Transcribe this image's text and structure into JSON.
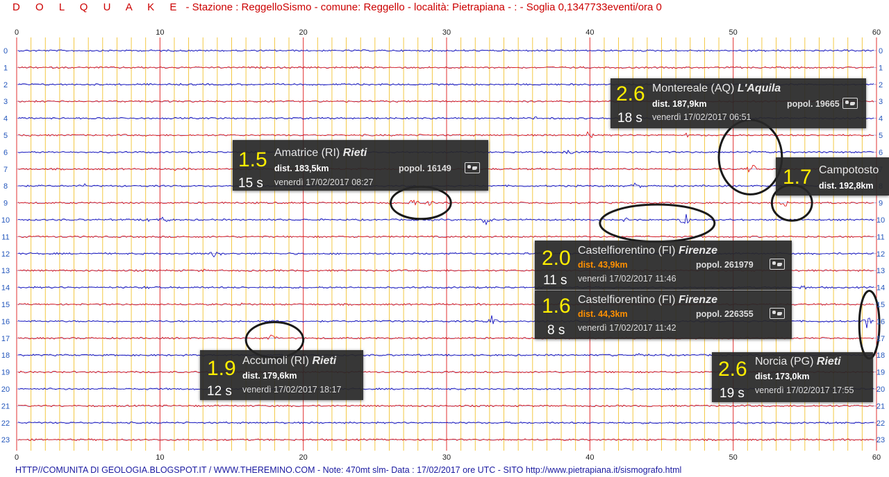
{
  "header": {
    "logo": "D O L Q U A  K E",
    "station": " - Stazione : ReggelloSismo - comune: Reggello - località: Pietrapiana - :  -  Soglia 0,1347733eventi/ora 0"
  },
  "footer": {
    "text": "HTTP//COMUNITA DI GEOLOGIA.BLOGSPOT.IT   /   WWW.THEREMINO.COM   -   Note: 470mt slm- Data : 17/02/2017 ore UTC - SITO http://www.pietrapiana.it/sismografo.html"
  },
  "colors": {
    "trace_red": "#dd0000",
    "trace_blue": "#0000bb",
    "grid_minor": "#f2c230",
    "grid_major": "#e03030",
    "grid_hour": "#9a9ad8",
    "axis_label": "#2255bb",
    "magnitude": "#ffee00",
    "near_distance": "#ff9000"
  },
  "chart_data": {
    "type": "line",
    "title": "",
    "xlabel": "",
    "ylabel": "",
    "xlim": [
      0,
      60
    ],
    "ylim": [
      0,
      23
    ],
    "x_ticks": [
      "0",
      "10",
      "20",
      "30",
      "40",
      "50",
      "60"
    ],
    "y_ticks": [
      "0",
      "1",
      "2",
      "3",
      "4",
      "5",
      "6",
      "7",
      "8",
      "9",
      "10",
      "11",
      "12",
      "13",
      "14",
      "15",
      "16",
      "17",
      "18",
      "19",
      "20",
      "21",
      "22",
      "23"
    ],
    "grid": true,
    "series": [
      {
        "row": 0,
        "values": [],
        "bursts": []
      },
      {
        "row": 1,
        "values": [],
        "bursts": []
      },
      {
        "row": 2,
        "values": [],
        "bursts": []
      },
      {
        "row": 3,
        "values": [],
        "bursts": []
      },
      {
        "row": 4,
        "values": [],
        "bursts": [
          [
            36.1,
            3
          ],
          [
            45.0,
            2
          ]
        ]
      },
      {
        "row": 5,
        "values": [],
        "bursts": [
          [
            39.9,
            7
          ],
          [
            46.6,
            4
          ],
          [
            0.9,
            2
          ]
        ]
      },
      {
        "row": 6,
        "values": [],
        "bursts": [
          [
            38.5,
            3
          ],
          [
            51.1,
            3
          ]
        ]
      },
      {
        "row": 7,
        "values": [],
        "bursts": [
          [
            51.3,
            9
          ],
          [
            11.0,
            2
          ]
        ]
      },
      {
        "row": 8,
        "values": [],
        "bursts": [
          [
            4.7,
            4
          ],
          [
            43.2,
            6
          ]
        ]
      },
      {
        "row": 9,
        "values": [],
        "bursts": [
          [
            27.8,
            7
          ],
          [
            28.7,
            5
          ],
          [
            53.6,
            6
          ]
        ]
      },
      {
        "row": 10,
        "values": [],
        "bursts": [
          [
            9.2,
            4
          ],
          [
            10.3,
            7
          ],
          [
            32.8,
            10
          ],
          [
            42.6,
            3
          ],
          [
            46.7,
            12
          ]
        ]
      },
      {
        "row": 11,
        "values": [],
        "bursts": []
      },
      {
        "row": 12,
        "values": [],
        "bursts": [
          [
            13.7,
            5
          ],
          [
            14.2,
            3
          ]
        ]
      },
      {
        "row": 13,
        "values": [],
        "bursts": [
          [
            12.9,
            3
          ]
        ]
      },
      {
        "row": 14,
        "values": [],
        "bursts": [
          [
            9.0,
            2
          ],
          [
            55.0,
            3
          ]
        ]
      },
      {
        "row": 15,
        "values": [],
        "bursts": [
          [
            15.7,
            2
          ]
        ]
      },
      {
        "row": 16,
        "values": [],
        "bursts": [
          [
            33.2,
            10
          ],
          [
            59.3,
            9
          ],
          [
            18.0,
            2
          ]
        ]
      },
      {
        "row": 17,
        "values": [],
        "bursts": [
          [
            17.8,
            6
          ]
        ]
      },
      {
        "row": 18,
        "values": [],
        "bursts": [
          [
            41.4,
            3
          ],
          [
            43.7,
            3
          ]
        ]
      },
      {
        "row": 19,
        "values": [],
        "bursts": [
          [
            0.5,
            4
          ]
        ]
      },
      {
        "row": 20,
        "values": [],
        "bursts": []
      },
      {
        "row": 21,
        "values": [],
        "bursts": []
      },
      {
        "row": 22,
        "values": [],
        "bursts": []
      },
      {
        "row": 23,
        "values": [],
        "bursts": []
      }
    ],
    "circled_events": [
      {
        "x": 28.2,
        "row": 9,
        "rx": 2.1,
        "ry": 0.95
      },
      {
        "x": 51.2,
        "row": 6.3,
        "rx": 2.2,
        "ry": 2.2
      },
      {
        "x": 54.1,
        "row": 9.0,
        "rx": 1.4,
        "ry": 1.05
      },
      {
        "x": 44.7,
        "row": 10.2,
        "rx": 4.0,
        "ry": 1.1
      },
      {
        "x": 18.0,
        "row": 17.1,
        "rx": 2.0,
        "ry": 1.05
      },
      {
        "x": 59.5,
        "row": 16.2,
        "rx": 0.7,
        "ry": 2.0
      }
    ]
  },
  "events": [
    {
      "magnitude": "2.6",
      "seconds": "18 s",
      "place": "Montereale (AQ)",
      "province": "L'Aquila",
      "distance": "dist. 187,9km",
      "population": "popol. 19665",
      "date": "venerdì 17/02/2017 06:51",
      "near": false
    },
    {
      "magnitude": "1.5",
      "seconds": "15 s",
      "place": "Amatrice (RI)",
      "province": "Rieti",
      "distance": "dist. 183,5km",
      "population": "popol. 16149",
      "date": "venerdì 17/02/2017 08:27",
      "near": false
    },
    {
      "magnitude": "1.7",
      "seconds": "",
      "place": "Campotosto",
      "province": "",
      "distance": "dist. 192,8km",
      "population": "",
      "date": "",
      "near": false
    },
    {
      "magnitude": "2.0",
      "seconds": "11 s",
      "place": "Castelfiorentino (FI)",
      "province": "Firenze",
      "distance": "dist. 43,9km",
      "population": "popol. 261979",
      "date": "venerdì 17/02/2017 11:46",
      "near": true
    },
    {
      "magnitude": "1.6",
      "seconds": "8 s",
      "place": "Castelfiorentino (FI)",
      "province": "Firenze",
      "distance": "dist. 44,3km",
      "population": "popol. 226355",
      "date": "venerdì 17/02/2017 11:42",
      "near": true
    },
    {
      "magnitude": "1.9",
      "seconds": "12 s",
      "place": "Accumoli (RI)",
      "province": "Rieti",
      "distance": "dist. 179,6km",
      "population": "",
      "date": "venerdì 17/02/2017 18:17",
      "near": false
    },
    {
      "magnitude": "2.6",
      "seconds": "19 s",
      "place": "Norcia (PG)",
      "province": "Rieti",
      "distance": "dist. 173,0km",
      "population": "",
      "date": "venerdì 17/02/2017 17:55",
      "near": false
    }
  ]
}
